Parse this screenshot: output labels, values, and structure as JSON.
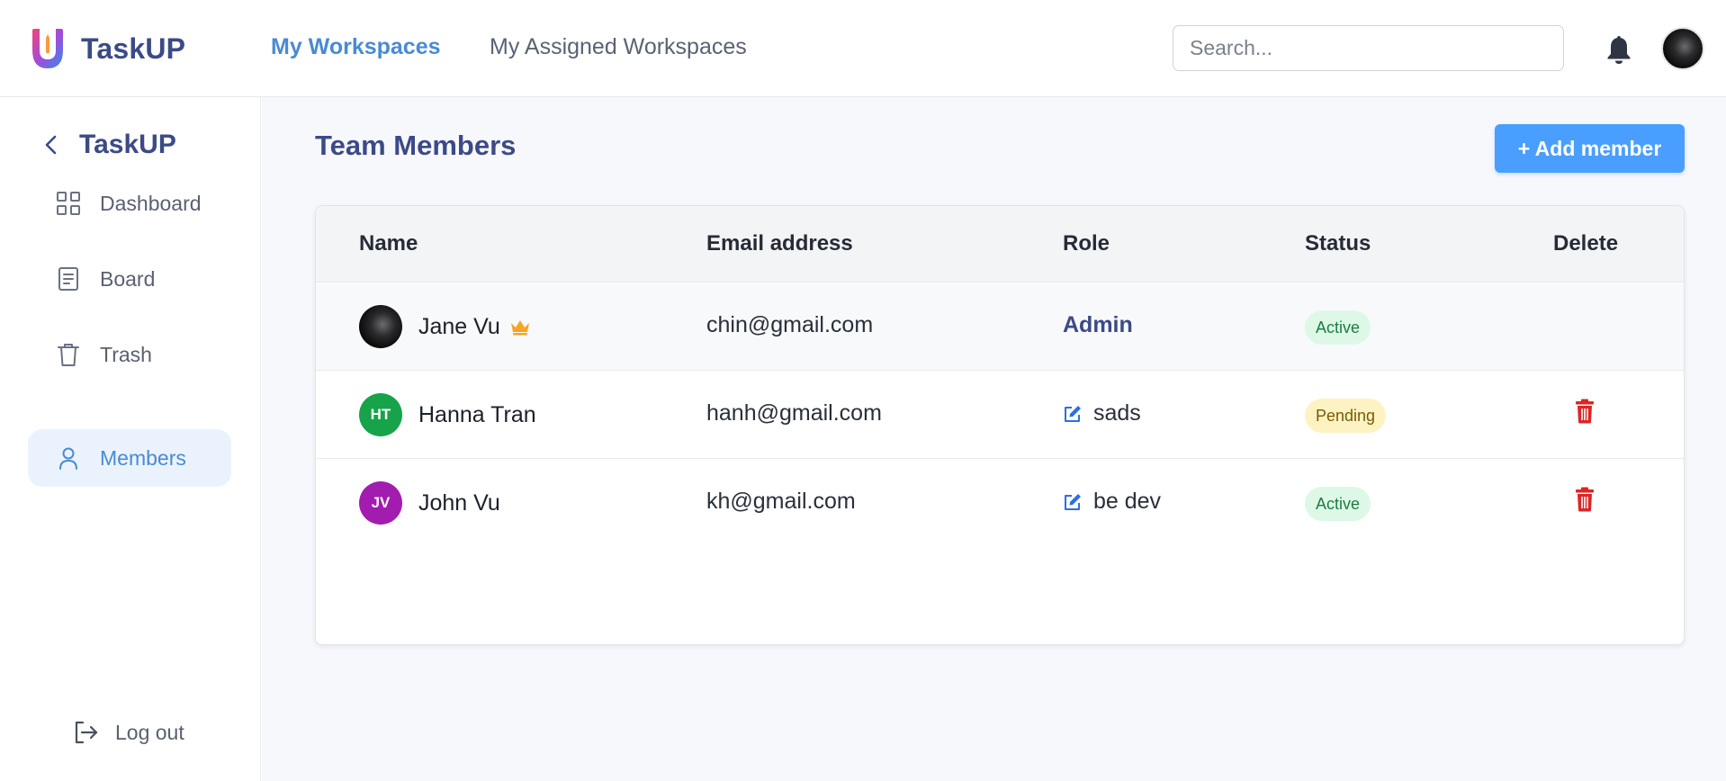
{
  "header": {
    "brand": "TaskUP",
    "nav": [
      "My Workspaces",
      "My Assigned Workspaces"
    ],
    "search_placeholder": "Search..."
  },
  "sidebar": {
    "title": "TaskUP",
    "items": [
      {
        "label": "Dashboard",
        "icon": "grid-icon"
      },
      {
        "label": "Board",
        "icon": "document-icon"
      },
      {
        "label": "Trash",
        "icon": "trash-icon"
      },
      {
        "label": "Members",
        "icon": "user-icon",
        "active": true
      }
    ],
    "logout": "Log out"
  },
  "main": {
    "title": "Team Members",
    "add_button": "+ Add member",
    "columns": [
      "Name",
      "Email address",
      "Role",
      "Status",
      "Delete"
    ],
    "rows": [
      {
        "name": "Jane Vu",
        "initials": "",
        "email": "chin@gmail.com",
        "role": "Admin",
        "status": "Active",
        "owner": true,
        "deletable": false
      },
      {
        "name": "Hanna Tran",
        "initials": "HT",
        "email": "hanh@gmail.com",
        "role": "sads",
        "status": "Pending",
        "owner": false,
        "deletable": true
      },
      {
        "name": "John Vu",
        "initials": "JV",
        "email": "kh@gmail.com",
        "role": "be dev",
        "status": "Active",
        "owner": false,
        "deletable": true
      }
    ]
  },
  "colors": {
    "brand": "#3c4a86",
    "accent": "#4a8ad4",
    "button": "#4a9eff",
    "avatar_ht": "#16a34a",
    "avatar_jv": "#a21caf",
    "danger": "#dc2626",
    "crown": "#f5a623"
  }
}
